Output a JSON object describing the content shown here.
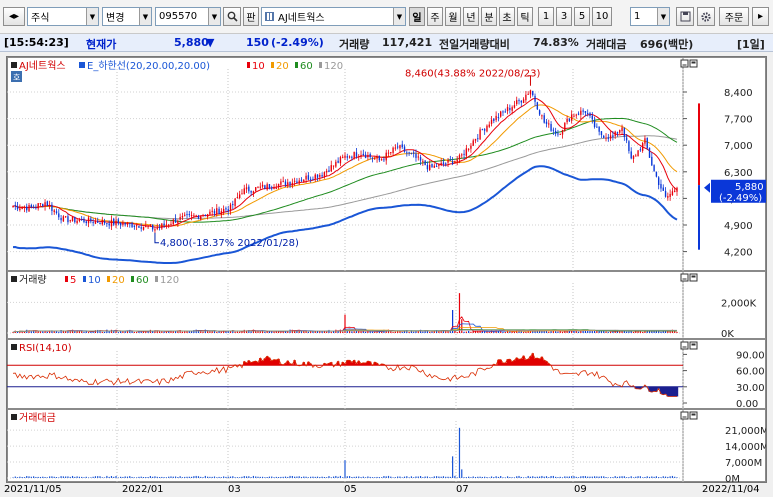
{
  "toolbar": {
    "market": "주식",
    "change_label": "변경",
    "code": "095570",
    "pan_label": "판",
    "stock_name": "AJ네트웍스",
    "periods": [
      "일",
      "주",
      "월",
      "년",
      "분",
      "초",
      "틱"
    ],
    "minute_buttons": [
      "1",
      "3",
      "5",
      "10"
    ],
    "interval_value": "1",
    "order_label": "주문"
  },
  "info": {
    "time": "[15:54:23]",
    "price_label": "현재가",
    "price": "5,880",
    "change_arrow": "▼",
    "change": "150",
    "change_pct": "(-2.49%)",
    "volume_label": "거래량",
    "volume": "117,421",
    "prevday_label": "전일거래량대비",
    "prevday_value": "74.83%",
    "amount_label": "거래대금",
    "amount": "696(백만)",
    "period_tag": "[1일]"
  },
  "legend": {
    "main": "AJ네트웍스",
    "envelope": "E_하한선(20,20.00,20.00)",
    "ma": [
      "10",
      "20",
      "60",
      "120"
    ],
    "volume": "거래량",
    "vol_ma": [
      "5",
      "10",
      "20",
      "60",
      "120"
    ],
    "rsi": "RSI(14,10)",
    "amount": "거래대금"
  },
  "price_axis": [
    "8,400",
    "7,700",
    "7,000",
    "6,300",
    "5,600",
    "4,900",
    "4,200"
  ],
  "volume_axis": [
    "2,000K",
    "0K"
  ],
  "rsi_axis": [
    "90.00",
    "60.00",
    "30.00",
    "0.00"
  ],
  "amount_axis": [
    "21,000M",
    "14,000M",
    "7,000M",
    "0M"
  ],
  "current_tag": {
    "price": "5,880",
    "pct": "(-2.49%)"
  },
  "annotations": {
    "high": "8,460(43.88% 2022/08/23)",
    "low": "4,800(-18.37% 2022/01/28)"
  },
  "date_axis": [
    "2021/11/05",
    "2022/01",
    "03",
    "05",
    "07",
    "09",
    "2022/11/04"
  ],
  "colors": {
    "up": "#e8000b",
    "down": "#0a37d8",
    "ma10": "#e8000b",
    "ma20": "#f19a00",
    "ma60": "#1f8c1f",
    "ma120": "#9a9a9a",
    "envelope": "#1a56d6",
    "rsi_line": "#d92b00",
    "rsi_fill_high": "#e00000",
    "rsi_fill_low": "#1b1f8f"
  },
  "chart_data": {
    "type": "candlestick",
    "close_start": 5400,
    "high_point": 8460,
    "low_point": 4800,
    "last_close": 5880,
    "rsi_levels": [
      70,
      30
    ]
  }
}
